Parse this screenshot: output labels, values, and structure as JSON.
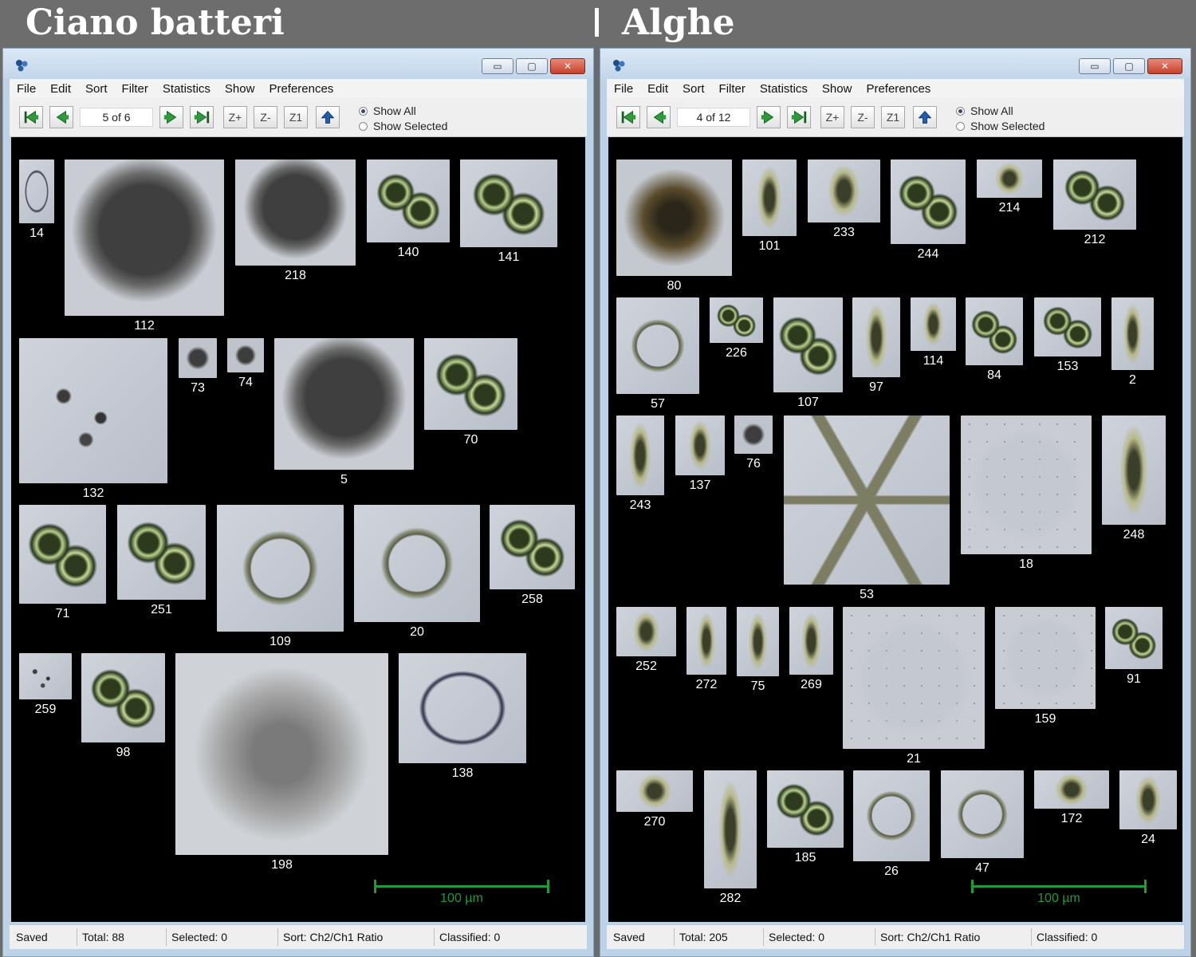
{
  "header": {
    "left_title": "Ciano batteri",
    "right_title": "Alghe"
  },
  "colors": {
    "gallery_bg": "#000000",
    "scale_bar": "#1f9a3c",
    "title_bar": "#c6d9ec",
    "close_button": "#d2523b"
  },
  "windows": [
    {
      "menu": [
        "File",
        "Edit",
        "Sort",
        "Filter",
        "Statistics",
        "Show",
        "Preferences"
      ],
      "toolbar": {
        "page": "5 of 6",
        "zoom_in": "Z+",
        "zoom_out": "Z-",
        "zoom_reset": "Z1",
        "show_all": "Show All",
        "show_selected": "Show Selected"
      },
      "window_buttons": {
        "minimize": "▭",
        "maximize": "▢",
        "close": "✕"
      },
      "particle_ids": [
        "14",
        "112",
        "218",
        "140",
        "141",
        "132",
        "73",
        "74",
        "5",
        "70",
        "71",
        "251",
        "109",
        "20",
        "258",
        "259",
        "98",
        "198",
        "138"
      ],
      "scale_label": "100 µm",
      "status": {
        "state": "Saved",
        "total": "Total:  88",
        "selected": "Selected:  0",
        "sort": "Sort: Ch2/Ch1 Ratio",
        "classified": "Classified:  0"
      }
    },
    {
      "menu": [
        "File",
        "Edit",
        "Sort",
        "Filter",
        "Statistics",
        "Show",
        "Preferences"
      ],
      "toolbar": {
        "page": "4 of 12",
        "zoom_in": "Z+",
        "zoom_out": "Z-",
        "zoom_reset": "Z1",
        "show_all": "Show All",
        "show_selected": "Show Selected"
      },
      "window_buttons": {
        "minimize": "▭",
        "maximize": "▢",
        "close": "✕"
      },
      "particle_ids": [
        "80",
        "101",
        "233",
        "244",
        "214",
        "212",
        "57",
        "226",
        "107",
        "97",
        "114",
        "84",
        "153",
        "2",
        "243",
        "137",
        "76",
        "53",
        "18",
        "248",
        "252",
        "272",
        "75",
        "269",
        "21",
        "159",
        "91",
        "270",
        "282",
        "185",
        "26",
        "47",
        "172",
        "24"
      ],
      "scale_label": "100 µm",
      "status": {
        "state": "Saved",
        "total": "Total:  205",
        "selected": "Selected:  0",
        "sort": "Sort: Ch2/Ch1 Ratio",
        "classified": "Classified:  0"
      }
    }
  ]
}
